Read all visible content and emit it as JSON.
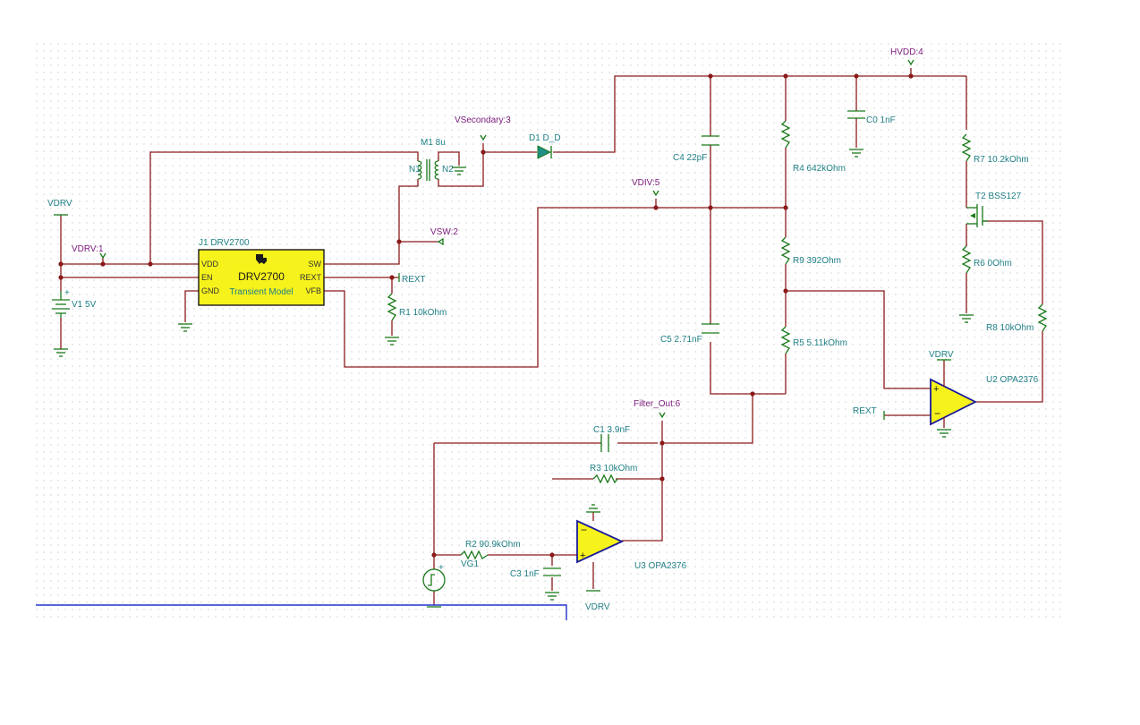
{
  "nets": {
    "vdrv_top": "VDRV",
    "vdrv_1": "VDRV:1",
    "vsecondary": "VSecondary:3",
    "hvdd": "HVDD:4",
    "vdiv": "VDIV:5",
    "vsw": "VSW:2",
    "filter_out": "Filter_Out:6",
    "vdrv_u2": "VDRV",
    "vdrv_u3": "VDRV",
    "rext_a": "REXT",
    "rext_b": "REXT",
    "vg1": "VG1"
  },
  "components": {
    "j1_ref": "J1 DRV2700",
    "j1_title": "DRV2700",
    "j1_sub": "Transient Model",
    "j1_pins": {
      "vdd": "VDD",
      "en": "EN",
      "gnd": "GND",
      "sw": "SW",
      "rext": "REXT",
      "vfb": "VFB"
    },
    "v1": "V1 5V",
    "r1": "R1 10kOhm",
    "m1": "M1 8u",
    "n1": "N1",
    "n2": "N2",
    "d1": "D1 D_D",
    "c4": "C4 22pF",
    "c0": "C0 1nF",
    "r4": "R4 642kOhm",
    "r9": "R9 392Ohm",
    "r5": "R5 5.11kOhm",
    "c5": "C5 2.71nF",
    "r7": "R7 10.2kOhm",
    "t2": "T2 BSS127",
    "r6": "R6 0Ohm",
    "r8": "R8 10kOhm",
    "u2": "U2 OPA2376",
    "c1": "C1 3.9nF",
    "r3": "R3 10kOhm",
    "r2": "R2 90.9kOhm",
    "c3": "C3 1nF",
    "u3": "U3 OPA2376"
  },
  "colors": {
    "wire": "#8b1a1a",
    "component": "#1a7a1a",
    "label": "#1f7f86",
    "net_label": "#7a1a7a",
    "chip_fill": "#f6f21c",
    "boundary_line": "#2233cc"
  }
}
